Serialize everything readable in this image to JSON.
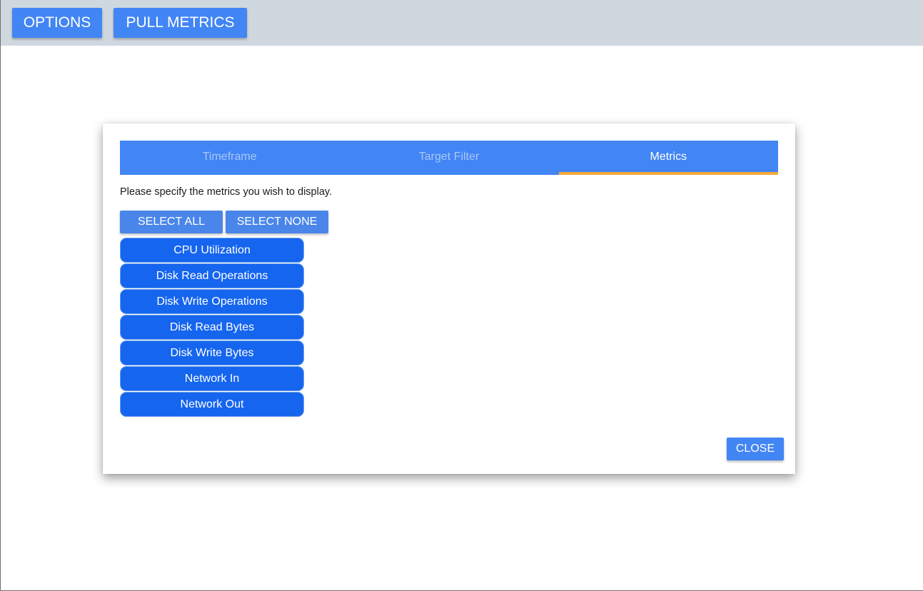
{
  "toolbar": {
    "options_label": "OPTIONS",
    "pull_metrics_label": "PULL METRICS"
  },
  "dialog": {
    "tabs": [
      {
        "label": "Timeframe",
        "active": false
      },
      {
        "label": "Target Filter",
        "active": false
      },
      {
        "label": "Metrics",
        "active": true
      }
    ],
    "instructions": "Please specify the metrics you wish to display.",
    "select_all_label": "SELECT ALL",
    "select_none_label": "SELECT NONE",
    "metrics": [
      {
        "label": "CPU Utilization",
        "selected": true
      },
      {
        "label": "Disk Read Operations",
        "selected": true
      },
      {
        "label": "Disk Write Operations",
        "selected": true
      },
      {
        "label": "Disk Read Bytes",
        "selected": true
      },
      {
        "label": "Disk Write Bytes",
        "selected": true
      },
      {
        "label": "Network In",
        "selected": true
      },
      {
        "label": "Network Out",
        "selected": true
      }
    ],
    "close_label": "CLOSE"
  },
  "colors": {
    "topbar_bg": "#cfd8df",
    "primary": "#4285f4",
    "metric_selected": "#1565ef",
    "tab_indicator": "#f5a93a",
    "tab_inactive_text": "#a9c7f7"
  }
}
